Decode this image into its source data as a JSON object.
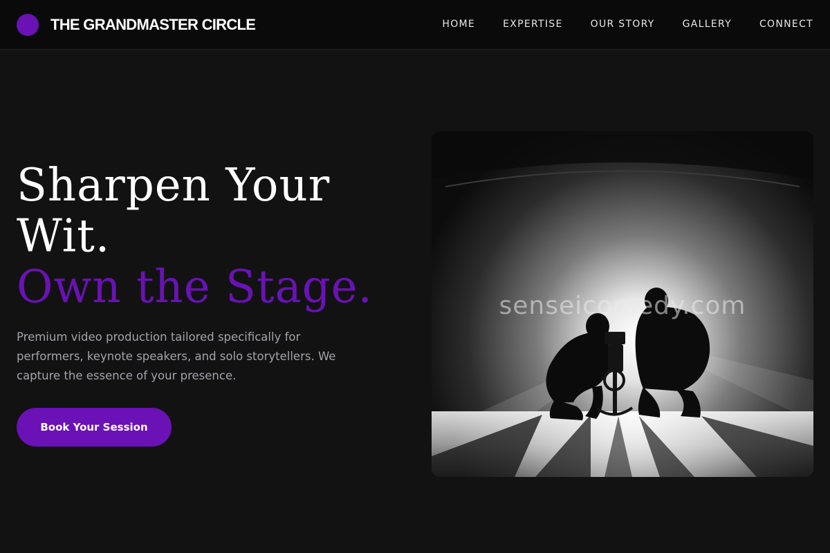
{
  "brand": {
    "name": "THE GRANDMASTER CIRCLE",
    "accent_color": "#6a12b5"
  },
  "nav": {
    "items": [
      {
        "label": "HOME"
      },
      {
        "label": "EXPERTISE"
      },
      {
        "label": "OUR STORY"
      },
      {
        "label": "GALLERY"
      },
      {
        "label": "CONNECT"
      }
    ]
  },
  "hero": {
    "headline_line1": "Sharpen Your",
    "headline_line2": "Wit.",
    "headline_line3": "Own the Stage.",
    "description": "Premium video production tailored specifically for performers, keynote speakers, and solo storytellers. We capture the essence of your presence.",
    "cta_label": "Book Your Session",
    "image_watermark": "senseicomedy.com",
    "image_icon": "film-crew-photo"
  },
  "colors": {
    "background": "#121213",
    "header_background": "#0a0a0b",
    "accent": "#6a12b5",
    "text": "#ffffff",
    "muted_text": "#a3a3ab"
  }
}
